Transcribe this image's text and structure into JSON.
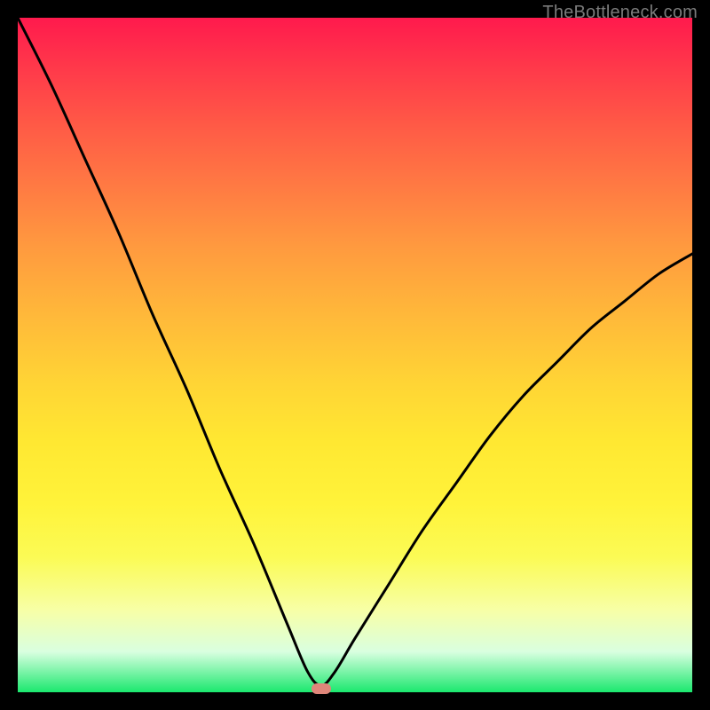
{
  "attribution": "TheBottleneck.com",
  "chart_data": {
    "type": "line",
    "title": "",
    "xlabel": "",
    "ylabel": "",
    "xlim": [
      0,
      100
    ],
    "ylim": [
      0,
      100
    ],
    "grid": false,
    "legend": false,
    "background_gradient": {
      "direction": "vertical",
      "stops": [
        {
          "pos": 0,
          "color": "#ff1a4d"
        },
        {
          "pos": 50,
          "color": "#ffd435"
        },
        {
          "pos": 100,
          "color": "#1be86e"
        }
      ]
    },
    "series": [
      {
        "name": "bottleneck-curve",
        "color": "#000000",
        "x": [
          0,
          5,
          10,
          15,
          20,
          25,
          30,
          35,
          40,
          43,
          45,
          47,
          50,
          55,
          60,
          65,
          70,
          75,
          80,
          85,
          90,
          95,
          100
        ],
        "values": [
          100,
          90,
          79,
          68,
          56,
          45,
          33,
          22,
          10,
          3,
          1,
          3,
          8,
          16,
          24,
          31,
          38,
          44,
          49,
          54,
          58,
          62,
          65
        ]
      }
    ],
    "annotations": [
      {
        "name": "minimum-marker",
        "shape": "pill",
        "color": "#e0867a",
        "x": 45,
        "y": 0
      }
    ]
  }
}
